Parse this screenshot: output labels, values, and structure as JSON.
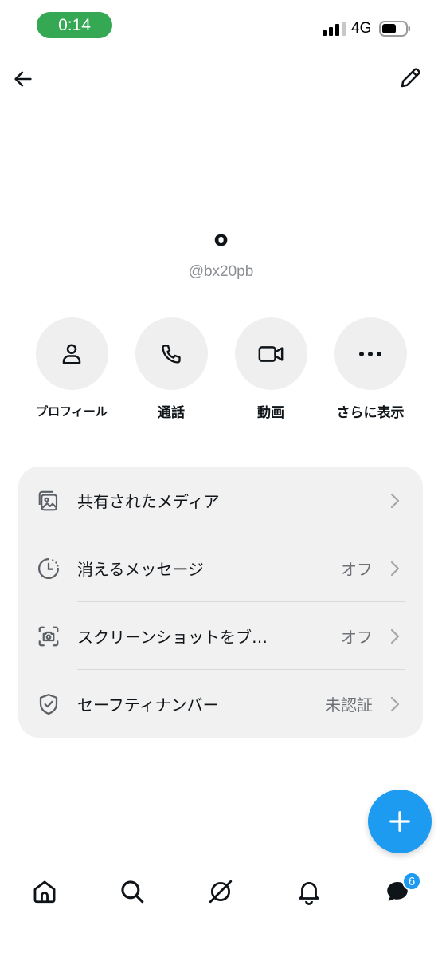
{
  "status_bar": {
    "time": "0:14",
    "network": "4G",
    "time_pill_color": "#34a853"
  },
  "profile": {
    "name": "o",
    "handle": "@bx20pb"
  },
  "actions": [
    {
      "label": "プロフィール",
      "icon": "person-icon"
    },
    {
      "label": "通話",
      "icon": "phone-icon"
    },
    {
      "label": "動画",
      "icon": "video-icon"
    },
    {
      "label": "さらに表示",
      "icon": "more-icon"
    }
  ],
  "settings": [
    {
      "label": "共有されたメディア",
      "value": "",
      "icon": "media-icon"
    },
    {
      "label": "消えるメッセージ",
      "value": "オフ",
      "icon": "timer-icon"
    },
    {
      "label": "スクリーンショットをブ…",
      "value": "オフ",
      "icon": "screenshot-icon"
    },
    {
      "label": "セーフティナンバー",
      "value": "未認証",
      "icon": "shield-icon"
    }
  ],
  "bottom_nav": {
    "items": [
      "home-icon",
      "search-icon",
      "grok-icon",
      "notifications-icon",
      "messages-icon"
    ],
    "messages_badge": "6"
  },
  "colors": {
    "accent": "#1d9bf0",
    "card_bg": "#f1f1f1",
    "action_bg": "#efefef"
  }
}
